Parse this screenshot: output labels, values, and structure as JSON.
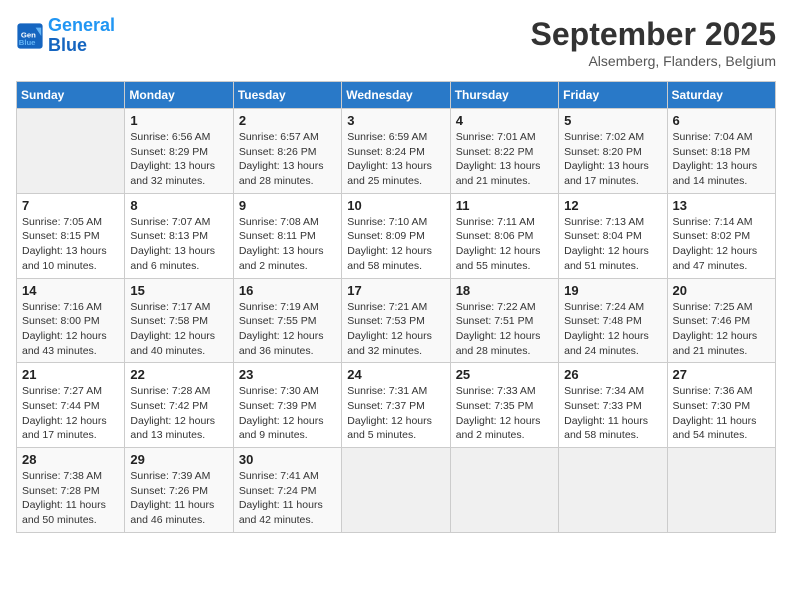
{
  "header": {
    "logo_line1": "General",
    "logo_line2": "Blue",
    "month": "September 2025",
    "location": "Alsemberg, Flanders, Belgium"
  },
  "days_of_week": [
    "Sunday",
    "Monday",
    "Tuesday",
    "Wednesday",
    "Thursday",
    "Friday",
    "Saturday"
  ],
  "weeks": [
    [
      {
        "day": "",
        "info": ""
      },
      {
        "day": "1",
        "info": "Sunrise: 6:56 AM\nSunset: 8:29 PM\nDaylight: 13 hours\nand 32 minutes."
      },
      {
        "day": "2",
        "info": "Sunrise: 6:57 AM\nSunset: 8:26 PM\nDaylight: 13 hours\nand 28 minutes."
      },
      {
        "day": "3",
        "info": "Sunrise: 6:59 AM\nSunset: 8:24 PM\nDaylight: 13 hours\nand 25 minutes."
      },
      {
        "day": "4",
        "info": "Sunrise: 7:01 AM\nSunset: 8:22 PM\nDaylight: 13 hours\nand 21 minutes."
      },
      {
        "day": "5",
        "info": "Sunrise: 7:02 AM\nSunset: 8:20 PM\nDaylight: 13 hours\nand 17 minutes."
      },
      {
        "day": "6",
        "info": "Sunrise: 7:04 AM\nSunset: 8:18 PM\nDaylight: 13 hours\nand 14 minutes."
      }
    ],
    [
      {
        "day": "7",
        "info": "Sunrise: 7:05 AM\nSunset: 8:15 PM\nDaylight: 13 hours\nand 10 minutes."
      },
      {
        "day": "8",
        "info": "Sunrise: 7:07 AM\nSunset: 8:13 PM\nDaylight: 13 hours\nand 6 minutes."
      },
      {
        "day": "9",
        "info": "Sunrise: 7:08 AM\nSunset: 8:11 PM\nDaylight: 13 hours\nand 2 minutes."
      },
      {
        "day": "10",
        "info": "Sunrise: 7:10 AM\nSunset: 8:09 PM\nDaylight: 12 hours\nand 58 minutes."
      },
      {
        "day": "11",
        "info": "Sunrise: 7:11 AM\nSunset: 8:06 PM\nDaylight: 12 hours\nand 55 minutes."
      },
      {
        "day": "12",
        "info": "Sunrise: 7:13 AM\nSunset: 8:04 PM\nDaylight: 12 hours\nand 51 minutes."
      },
      {
        "day": "13",
        "info": "Sunrise: 7:14 AM\nSunset: 8:02 PM\nDaylight: 12 hours\nand 47 minutes."
      }
    ],
    [
      {
        "day": "14",
        "info": "Sunrise: 7:16 AM\nSunset: 8:00 PM\nDaylight: 12 hours\nand 43 minutes."
      },
      {
        "day": "15",
        "info": "Sunrise: 7:17 AM\nSunset: 7:58 PM\nDaylight: 12 hours\nand 40 minutes."
      },
      {
        "day": "16",
        "info": "Sunrise: 7:19 AM\nSunset: 7:55 PM\nDaylight: 12 hours\nand 36 minutes."
      },
      {
        "day": "17",
        "info": "Sunrise: 7:21 AM\nSunset: 7:53 PM\nDaylight: 12 hours\nand 32 minutes."
      },
      {
        "day": "18",
        "info": "Sunrise: 7:22 AM\nSunset: 7:51 PM\nDaylight: 12 hours\nand 28 minutes."
      },
      {
        "day": "19",
        "info": "Sunrise: 7:24 AM\nSunset: 7:48 PM\nDaylight: 12 hours\nand 24 minutes."
      },
      {
        "day": "20",
        "info": "Sunrise: 7:25 AM\nSunset: 7:46 PM\nDaylight: 12 hours\nand 21 minutes."
      }
    ],
    [
      {
        "day": "21",
        "info": "Sunrise: 7:27 AM\nSunset: 7:44 PM\nDaylight: 12 hours\nand 17 minutes."
      },
      {
        "day": "22",
        "info": "Sunrise: 7:28 AM\nSunset: 7:42 PM\nDaylight: 12 hours\nand 13 minutes."
      },
      {
        "day": "23",
        "info": "Sunrise: 7:30 AM\nSunset: 7:39 PM\nDaylight: 12 hours\nand 9 minutes."
      },
      {
        "day": "24",
        "info": "Sunrise: 7:31 AM\nSunset: 7:37 PM\nDaylight: 12 hours\nand 5 minutes."
      },
      {
        "day": "25",
        "info": "Sunrise: 7:33 AM\nSunset: 7:35 PM\nDaylight: 12 hours\nand 2 minutes."
      },
      {
        "day": "26",
        "info": "Sunrise: 7:34 AM\nSunset: 7:33 PM\nDaylight: 11 hours\nand 58 minutes."
      },
      {
        "day": "27",
        "info": "Sunrise: 7:36 AM\nSunset: 7:30 PM\nDaylight: 11 hours\nand 54 minutes."
      }
    ],
    [
      {
        "day": "28",
        "info": "Sunrise: 7:38 AM\nSunset: 7:28 PM\nDaylight: 11 hours\nand 50 minutes."
      },
      {
        "day": "29",
        "info": "Sunrise: 7:39 AM\nSunset: 7:26 PM\nDaylight: 11 hours\nand 46 minutes."
      },
      {
        "day": "30",
        "info": "Sunrise: 7:41 AM\nSunset: 7:24 PM\nDaylight: 11 hours\nand 42 minutes."
      },
      {
        "day": "",
        "info": ""
      },
      {
        "day": "",
        "info": ""
      },
      {
        "day": "",
        "info": ""
      },
      {
        "day": "",
        "info": ""
      }
    ]
  ]
}
